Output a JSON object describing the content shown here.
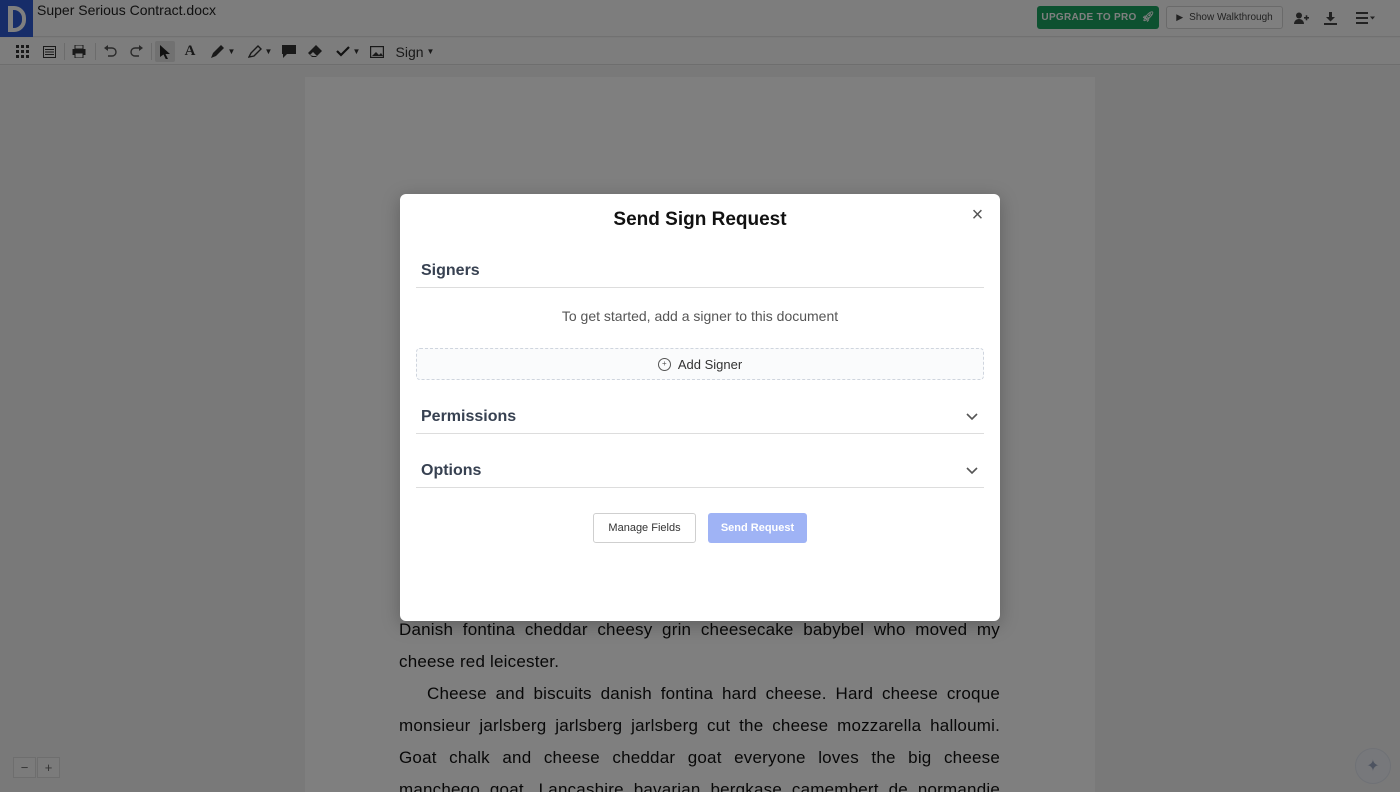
{
  "app": {
    "document_title": "Super Serious Contract.docx"
  },
  "topbar": {
    "upgrade_label": "UPGRADE TO PRO",
    "walkthrough_label": "Show Walkthrough",
    "icons": [
      "share-user-icon",
      "download-icon",
      "menu-icon"
    ]
  },
  "toolbar": {
    "sign_label": "Sign",
    "icons": [
      "grid-icon",
      "list-icon",
      "print-icon",
      "undo-icon",
      "redo-icon",
      "pointer-icon",
      "text-icon",
      "pen-icon",
      "highlighter-icon",
      "comment-icon",
      "eraser-icon",
      "checkmark-icon",
      "image-icon"
    ]
  },
  "document": {
    "paragraph_1_lines": [
      "Danish fontina cheddar cheesy grin cheesecake babybel who moved my",
      "cheese red leicester."
    ],
    "paragraph_2_lines": [
      "Cheese and biscuits danish fontina hard cheese. Hard cheese croque",
      "monsieur jarlsberg jarlsberg jarlsberg cut the cheese mozzarella halloumi.",
      "Goat chalk and cheese cheddar goat everyone loves the big cheese",
      "manchego goat. Lancashire bavarian bergkase camembert de normandie"
    ]
  },
  "zoom": {
    "minus_label": "−",
    "plus_label": "+"
  },
  "modal": {
    "title": "Send Sign Request",
    "close_label": "×",
    "signers_heading": "Signers",
    "signers_hint": "To get started, add a signer to this document",
    "add_signer_label": "Add Signer",
    "permissions_heading": "Permissions",
    "options_heading": "Options",
    "manage_fields_label": "Manage Fields",
    "send_request_label": "Send Request"
  },
  "colors": {
    "brand_blue": "#2f5bd3",
    "upgrade_green": "#1aa260",
    "send_button_disabled": "#9fb3f5"
  }
}
